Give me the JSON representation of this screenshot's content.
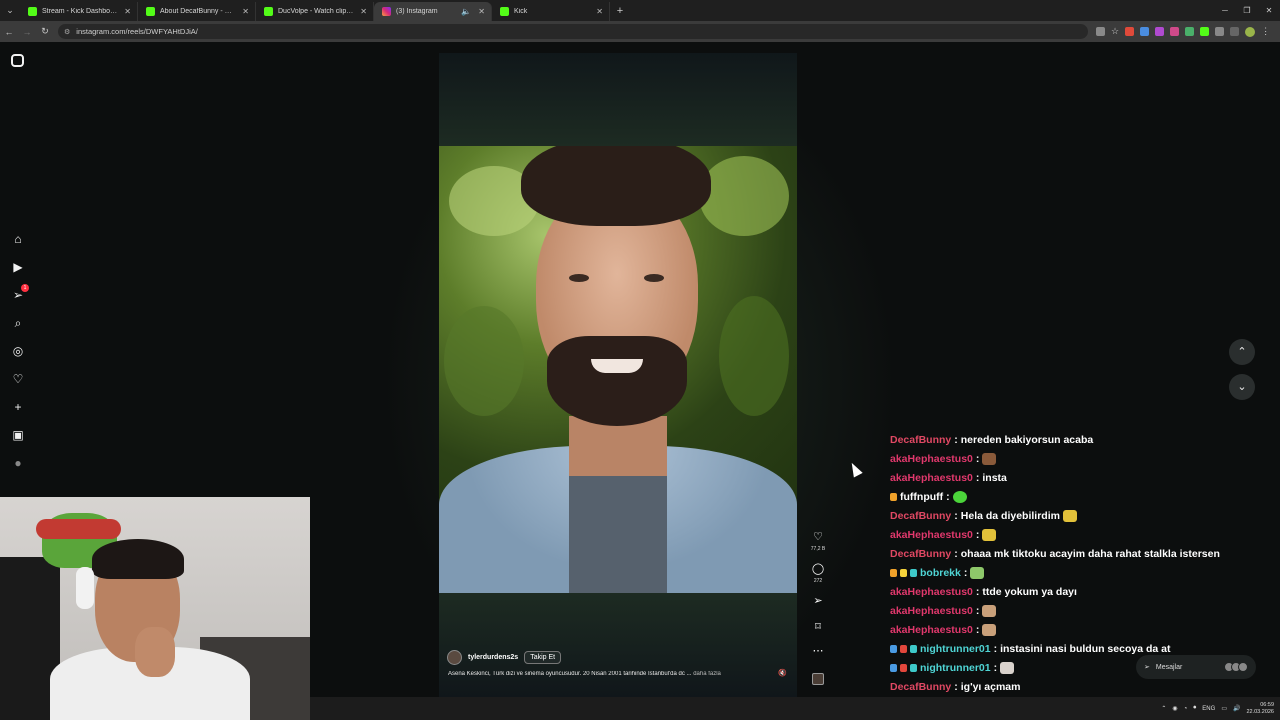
{
  "browser": {
    "tabs": [
      {
        "title": "Stream - Kick Dashboard",
        "icon": "kick",
        "active": false
      },
      {
        "title": "About DecafBunny - Watch Live",
        "icon": "kick",
        "active": false
      },
      {
        "title": "DucVolpe - Watch clips on Kick",
        "icon": "kick",
        "active": false
      },
      {
        "title": "(3) Instagram",
        "icon": "instagram",
        "active": true
      },
      {
        "title": "Kick",
        "icon": "kick",
        "active": false
      }
    ],
    "url": "instagram.com/reels/DWFYAHtDJiA/"
  },
  "sidebar": {
    "notification_badge": "1"
  },
  "reel": {
    "author": "tylerdurdens2s",
    "follow_label": "Takip Et",
    "caption": "Asena Keskinci, Türk dizi ve sinema oyuncusudur. 20 Nisan 2001 tarihinde İstanbul'da dc ...",
    "caption_more": "daha fazla",
    "likes": "77,2 B",
    "comments": "272"
  },
  "chat": {
    "messages": [
      {
        "user": "DecafBunny",
        "cls": "u-decaf",
        "badges": [],
        "text": "nereden bakiyorsun acaba",
        "emote": ""
      },
      {
        "user": "akaHephaestus0",
        "cls": "u-aka",
        "badges": [],
        "text": "",
        "emote": "e-brown"
      },
      {
        "user": "akaHephaestus0",
        "cls": "u-aka",
        "badges": [],
        "text": "insta",
        "emote": ""
      },
      {
        "user": "fuffnpuff",
        "cls": "u-fuff",
        "badges": [
          "bd-o"
        ],
        "text": "",
        "emote": "e-green"
      },
      {
        "user": "DecafBunny",
        "cls": "u-decaf",
        "badges": [],
        "text": "Hela da diyebilirdim",
        "emote": "e-yellow"
      },
      {
        "user": "akaHephaestus0",
        "cls": "u-aka",
        "badges": [],
        "text": "",
        "emote": "e-yellow"
      },
      {
        "user": "DecafBunny",
        "cls": "u-decaf",
        "badges": [],
        "text": "ohaaa mk tiktoku acayim daha rahat stalkla istersen",
        "emote": ""
      },
      {
        "user": "bobrekk",
        "cls": "u-bob",
        "badges": [
          "bd-o",
          "bd-y",
          "bd-c"
        ],
        "text": "",
        "emote": "e-money"
      },
      {
        "user": "akaHephaestus0",
        "cls": "u-aka",
        "badges": [],
        "text": "ttde yokum ya dayı",
        "emote": ""
      },
      {
        "user": "akaHephaestus0",
        "cls": "u-aka",
        "badges": [],
        "text": "",
        "emote": "e-tan"
      },
      {
        "user": "akaHephaestus0",
        "cls": "u-aka",
        "badges": [],
        "text": "",
        "emote": "e-tan"
      },
      {
        "user": "nightrunner01",
        "cls": "u-night",
        "badges": [
          "bd-b",
          "bd-r",
          "bd-c"
        ],
        "text": "instasini nasi buldun secoya da at",
        "emote": ""
      },
      {
        "user": "nightrunner01",
        "cls": "u-night",
        "badges": [
          "bd-b",
          "bd-r",
          "bd-c"
        ],
        "text": "",
        "emote": "e-cat"
      },
      {
        "user": "DecafBunny",
        "cls": "u-decaf",
        "badges": [],
        "text": "ig'yı açmam",
        "emote": ""
      },
      {
        "user": "bobrekk",
        "cls": "u-bob",
        "badges": [
          "bd-o",
          "bd-y",
          "bd-c"
        ],
        "text": "",
        "emote": "e-money"
      }
    ]
  },
  "messages_pill": {
    "label": "Mesajlar"
  },
  "taskbar": {
    "lang": "ENG",
    "time": "06:59",
    "date": "22.03.2026"
  }
}
